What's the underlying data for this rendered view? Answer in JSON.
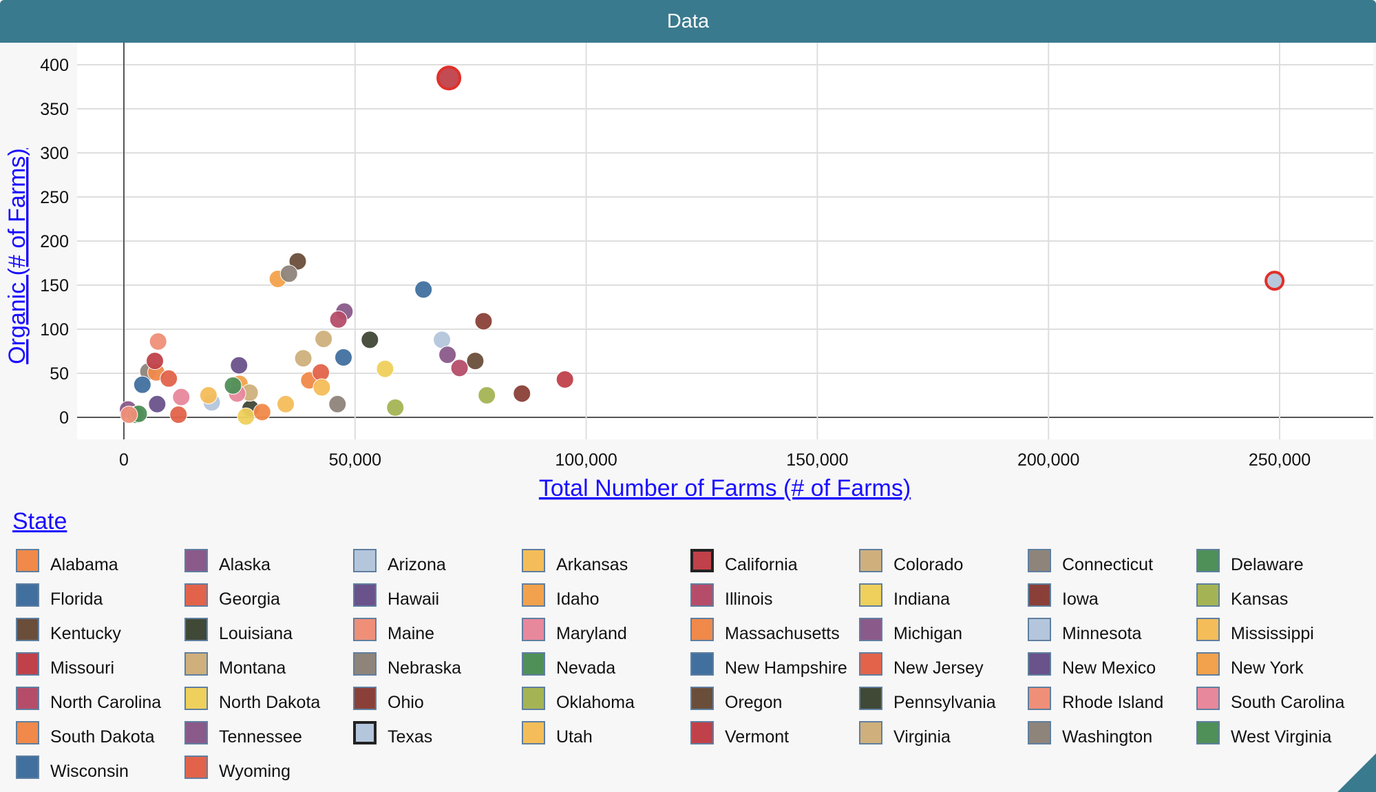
{
  "window": {
    "title": "Data"
  },
  "chart_data": {
    "type": "scatter",
    "xlabel": "Total Number of Farms (# of Farms)",
    "ylabel": "Organic (# of Farms)",
    "xlim": [
      -10000,
      270000
    ],
    "ylim": [
      -25,
      420
    ],
    "xticks": [
      0,
      50000,
      100000,
      150000,
      200000,
      250000
    ],
    "xtick_labels": [
      "0",
      "50,000",
      "100,000",
      "150,000",
      "200,000",
      "250,000"
    ],
    "yticks": [
      0,
      50,
      100,
      150,
      200,
      250,
      300,
      350,
      400
    ],
    "ytick_labels": [
      "0",
      "50",
      "100",
      "150",
      "200",
      "250",
      "300",
      "350",
      "400"
    ],
    "grid": true,
    "legend": {
      "title": "State",
      "placement": "bottom"
    },
    "highlighted": [
      "California",
      "Texas"
    ],
    "series": [
      {
        "name": "Alabama",
        "color": "#f0894a",
        "x": 40100,
        "y": 42
      },
      {
        "name": "Alaska",
        "color": "#8a5a8a",
        "x": 900,
        "y": 9
      },
      {
        "name": "Arizona",
        "color": "#b4c6dc",
        "x": 19000,
        "y": 17
      },
      {
        "name": "Arkansas",
        "color": "#f4bd5a",
        "x": 35000,
        "y": 15
      },
      {
        "name": "California",
        "color": "#c0414a",
        "x": 70300,
        "y": 385
      },
      {
        "name": "Colorado",
        "color": "#cfb07c",
        "x": 38800,
        "y": 67
      },
      {
        "name": "Connecticut",
        "color": "#8e847a",
        "x": 5300,
        "y": 52
      },
      {
        "name": "Delaware",
        "color": "#4f8f58",
        "x": 2500,
        "y": 3
      },
      {
        "name": "Florida",
        "color": "#41709f",
        "x": 47500,
        "y": 68
      },
      {
        "name": "Georgia",
        "color": "#e2634a",
        "x": 42600,
        "y": 51
      },
      {
        "name": "Hawaii",
        "color": "#6a528a",
        "x": 7200,
        "y": 15
      },
      {
        "name": "Idaho",
        "color": "#f2a24c",
        "x": 25000,
        "y": 38
      },
      {
        "name": "Illinois",
        "color": "#b54d6a",
        "x": 72600,
        "y": 56
      },
      {
        "name": "Indiana",
        "color": "#efd05c",
        "x": 56500,
        "y": 55
      },
      {
        "name": "Iowa",
        "color": "#8a4038",
        "x": 86100,
        "y": 27
      },
      {
        "name": "Kansas",
        "color": "#a4b454",
        "x": 58700,
        "y": 11
      },
      {
        "name": "Kentucky",
        "color": "#6a4e3a",
        "x": 76000,
        "y": 64
      },
      {
        "name": "Louisiana",
        "color": "#404836",
        "x": 27400,
        "y": 10
      },
      {
        "name": "Maine",
        "color": "#ef8f78",
        "x": 7400,
        "y": 86
      },
      {
        "name": "Maryland",
        "color": "#e8889c",
        "x": 12400,
        "y": 23
      },
      {
        "name": "Massachusetts",
        "color": "#f0894a",
        "x": 7000,
        "y": 51
      },
      {
        "name": "Michigan",
        "color": "#8a5a8a",
        "x": 47700,
        "y": 120
      },
      {
        "name": "Minnesota",
        "color": "#b4c6dc",
        "x": 68800,
        "y": 88
      },
      {
        "name": "Mississippi",
        "color": "#f4bd5a",
        "x": 42800,
        "y": 34
      },
      {
        "name": "Missouri",
        "color": "#c0414a",
        "x": 95400,
        "y": 43
      },
      {
        "name": "Montana",
        "color": "#cfb07c",
        "x": 27200,
        "y": 28
      },
      {
        "name": "Nebraska",
        "color": "#8e847a",
        "x": 46200,
        "y": 15
      },
      {
        "name": "Nevada",
        "color": "#4f8f58",
        "x": 3200,
        "y": 4
      },
      {
        "name": "New Hampshire",
        "color": "#41709f",
        "x": 4000,
        "y": 37
      },
      {
        "name": "New Jersey",
        "color": "#e2634a",
        "x": 9700,
        "y": 44
      },
      {
        "name": "New Mexico",
        "color": "#6a528a",
        "x": 24900,
        "y": 59
      },
      {
        "name": "New York",
        "color": "#f2a24c",
        "x": 33300,
        "y": 157
      },
      {
        "name": "North Carolina",
        "color": "#b54d6a",
        "x": 46400,
        "y": 111
      },
      {
        "name": "North Dakota",
        "color": "#efd05c",
        "x": 26400,
        "y": 1
      },
      {
        "name": "Ohio",
        "color": "#8a4038",
        "x": 77800,
        "y": 109
      },
      {
        "name": "Oklahoma",
        "color": "#a4b454",
        "x": 78500,
        "y": 25
      },
      {
        "name": "Oregon",
        "color": "#6a4e3a",
        "x": 37600,
        "y": 177
      },
      {
        "name": "Pennsylvania",
        "color": "#404836",
        "x": 53200,
        "y": 88
      },
      {
        "name": "Rhode Island",
        "color": "#ef8f78",
        "x": 1100,
        "y": 3
      },
      {
        "name": "South Carolina",
        "color": "#e8889c",
        "x": 24500,
        "y": 27
      },
      {
        "name": "South Dakota",
        "color": "#f0894a",
        "x": 29900,
        "y": 6
      },
      {
        "name": "Tennessee",
        "color": "#8a5a8a",
        "x": 70000,
        "y": 71
      },
      {
        "name": "Texas",
        "color": "#b4c6dc",
        "x": 248900,
        "y": 155
      },
      {
        "name": "Utah",
        "color": "#f4bd5a",
        "x": 18300,
        "y": 25
      },
      {
        "name": "Vermont",
        "color": "#c0414a",
        "x": 6700,
        "y": 64
      },
      {
        "name": "Virginia",
        "color": "#cfb07c",
        "x": 43200,
        "y": 89
      },
      {
        "name": "Washington",
        "color": "#8e847a",
        "x": 35700,
        "y": 163
      },
      {
        "name": "West Virginia",
        "color": "#4f8f58",
        "x": 23600,
        "y": 36
      },
      {
        "name": "Wisconsin",
        "color": "#41709f",
        "x": 64800,
        "y": 145
      },
      {
        "name": "Wyoming",
        "color": "#e2634a",
        "x": 11800,
        "y": 3
      }
    ]
  }
}
